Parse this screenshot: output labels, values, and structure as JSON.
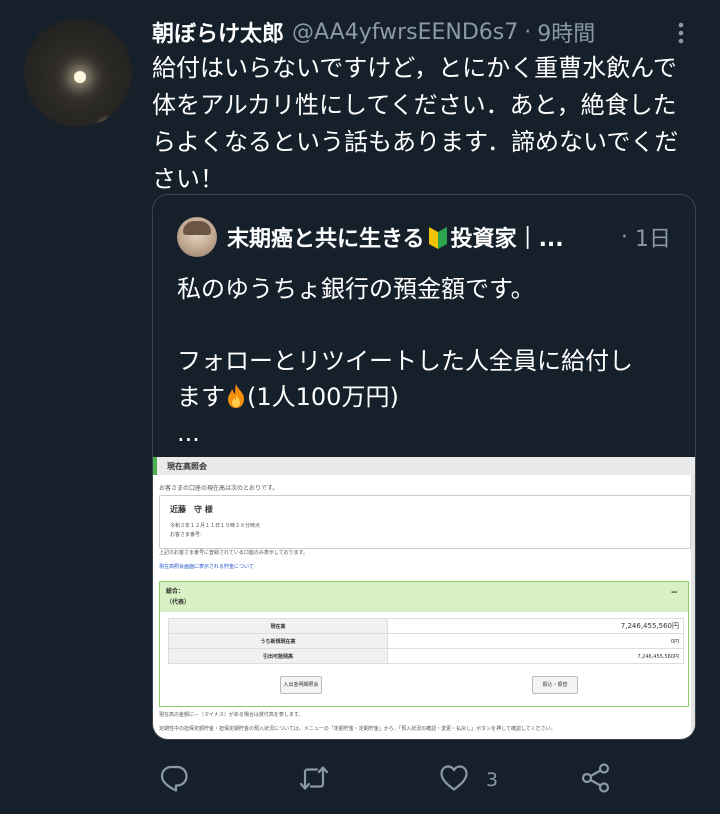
{
  "tweet": {
    "author_name": "朝ぼらけ太郎",
    "handle": "@AA4yfwrsEEND6s7",
    "separator": "·",
    "time": "9時間",
    "text": "給付はいらないですけど，とにかく重曹水飲んで体をアルカリ性にしてください．あと，絶食したらよくなるという話もあります．諦めないでください！"
  },
  "quote": {
    "author_name_part1": "末期癌と共に生きる",
    "author_name_part2": "投資家｜...",
    "separator": "·",
    "time": "1日",
    "text_line1": "私のゆうちょ銀行の預金額です。",
    "text_line2": "フォローとリツイートした人全員に給付し",
    "text_line3a": "ます",
    "text_line3b": "(1人100万円)",
    "text_line4": "...",
    "screenshot": {
      "title": "現在高照会",
      "subtitle": "お客さまの口座の現在高は次のとおりです。",
      "name": "近藤　守 様",
      "info_line1": "令和３年１２月１１日１９時２６分時点",
      "info_line2": "お客さま番号：",
      "note": "上記のお客さま番号に登録されている口座のみ表示しております。",
      "link": "現在高照会画面に表示される貯金について",
      "account_label": "総合：",
      "account_sub": "（代表）",
      "rows": [
        {
          "label": "現在高",
          "value": "7,246,455,560円"
        },
        {
          "label": "うち新規現在高",
          "value": "0円"
        },
        {
          "label": "引出可能残高",
          "value": "7,246,455,560円"
        }
      ],
      "button1": "入出金明細照会",
      "button2": "振込・振替",
      "footer1": "現在高の金額に－（マイナス）がある場合は貸付高を表します。",
      "footer2": "定期性中の担保定額貯金・担保定期貯金の預入状況については，メニューの「定額貯金・定期貯金」から，「預入状況の確認・変更・払戻し」ボタンを押して確認してください。"
    }
  },
  "actions": {
    "reply_icon": "reply-icon",
    "retweet_icon": "retweet-icon",
    "like_icon": "heart-icon",
    "like_count": "3",
    "share_icon": "share-icon"
  },
  "colors": {
    "background": "#15202b",
    "secondary_text": "#8b98a5",
    "border": "#38444d"
  }
}
